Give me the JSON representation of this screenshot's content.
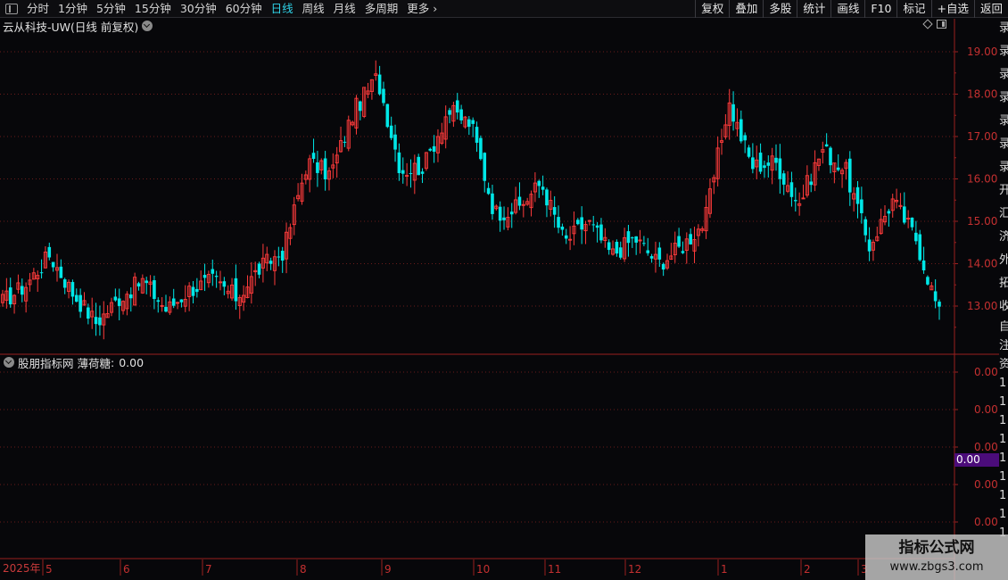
{
  "toolbar": {
    "periods": [
      "分时",
      "1分钟",
      "5分钟",
      "15分钟",
      "30分钟",
      "60分钟",
      "日线",
      "周线",
      "月线",
      "多周期",
      "更多"
    ],
    "active_period": "日线",
    "right_buttons": [
      "复权",
      "叠加",
      "多股",
      "统计",
      "画线",
      "F10",
      "标记",
      "+自选",
      "返回"
    ]
  },
  "main_chart": {
    "title": "云从科技-UW(日线 前复权)"
  },
  "indicator": {
    "name": "股朋指标网",
    "series_label": "薄荷糖",
    "value": "0.00",
    "cursor_value": "0.00"
  },
  "time_axis": {
    "year_label": "2025年"
  },
  "side_panel_glyphs": [
    "录",
    "录",
    "录",
    "录",
    "录",
    "录",
    "录",
    "开",
    "汇",
    "济",
    "外",
    "拓",
    "收"
  ],
  "side_panel_lower_glyphs": [
    "自",
    "注",
    "资",
    "1",
    "1",
    "1",
    "1",
    "1",
    "1",
    "1",
    "1",
    "1"
  ],
  "watermark": {
    "line1": "指标公式网",
    "line2": "www.zbgs3.com"
  },
  "colors": {
    "up": "#ff3b3b",
    "down": "#00e7e7",
    "grid": "#6a1b1b",
    "axis": "#9a1f1f",
    "active": "#2fd3e8"
  },
  "chart_data": [
    {
      "type": "candlestick",
      "title": "云从科技-UW(日线 前复权)",
      "x_tick_labels": [
        "2025年",
        "5",
        "6",
        "7",
        "8",
        "9",
        "10",
        "11",
        "12",
        "1",
        "2",
        "3"
      ],
      "y_tick_labels": [
        "19.00",
        "18.00",
        "17.00",
        "16.00",
        "15.00",
        "14.00",
        "13.00"
      ],
      "ylim": [
        12.1,
        19.6
      ],
      "close_anchors": [
        {
          "month": "4",
          "close": 13.1
        },
        {
          "month": "4",
          "close": 13.5
        },
        {
          "month": "4",
          "close": 14.2
        },
        {
          "month": "5",
          "close": 13.3
        },
        {
          "month": "5",
          "close": 12.6
        },
        {
          "month": "5",
          "close": 13.2
        },
        {
          "month": "6",
          "close": 13.6
        },
        {
          "month": "6",
          "close": 12.9
        },
        {
          "month": "6",
          "close": 13.4
        },
        {
          "month": "7",
          "close": 13.6
        },
        {
          "month": "7",
          "close": 13.2
        },
        {
          "month": "7",
          "close": 13.9
        },
        {
          "month": "8",
          "close": 14.3
        },
        {
          "month": "8",
          "close": 16.4
        },
        {
          "month": "8",
          "close": 16.1
        },
        {
          "month": "8",
          "close": 17.6
        },
        {
          "month": "9",
          "close": 18.4
        },
        {
          "month": "9",
          "close": 16.2
        },
        {
          "month": "9",
          "close": 16.3
        },
        {
          "month": "9",
          "close": 17.6
        },
        {
          "month": "10",
          "close": 17.3
        },
        {
          "month": "10",
          "close": 15.2
        },
        {
          "month": "10",
          "close": 15.3
        },
        {
          "month": "11",
          "close": 15.9
        },
        {
          "month": "11",
          "close": 14.5
        },
        {
          "month": "11",
          "close": 15.0
        },
        {
          "month": "12",
          "close": 14.2
        },
        {
          "month": "12",
          "close": 14.6
        },
        {
          "month": "12",
          "close": 14.0
        },
        {
          "month": "12",
          "close": 14.4
        },
        {
          "month": "1",
          "close": 15.0
        },
        {
          "month": "1",
          "close": 17.8
        },
        {
          "month": "1",
          "close": 16.3
        },
        {
          "month": "1",
          "close": 16.4
        },
        {
          "month": "2",
          "close": 15.4
        },
        {
          "month": "2",
          "close": 16.7
        },
        {
          "month": "2",
          "close": 16.2
        },
        {
          "month": "3",
          "close": 14.4
        },
        {
          "month": "3",
          "close": 15.5
        },
        {
          "month": "3",
          "close": 14.6
        },
        {
          "month": "3",
          "close": 12.8
        }
      ]
    },
    {
      "type": "line",
      "title": "股朋指标网 薄荷糖",
      "series": [
        {
          "name": "薄荷糖",
          "values": [
            0.0
          ]
        }
      ],
      "y_tick_labels": [
        "0.00",
        "0.00",
        "0.00",
        "0.00",
        "0.00"
      ]
    }
  ]
}
